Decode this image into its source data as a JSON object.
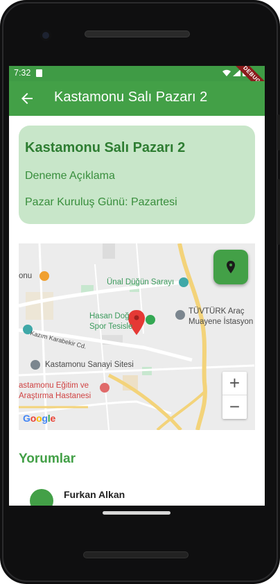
{
  "status_bar": {
    "time": "7:32",
    "debug_label": "DEBUG"
  },
  "app_bar": {
    "title": "Kastamonu Salı Pazarı 2"
  },
  "market_card": {
    "title": "Kastamonu Salı Pazarı 2",
    "description": "Deneme Açıklama",
    "founding_day": "Pazar Kuruluş Günü: Pazartesi"
  },
  "map": {
    "labels": {
      "cafe": "onu",
      "wedding_hall": "Ünal Düğün Sarayı",
      "tuvturk_line1": "TÜVTÜRK Araç",
      "tuvturk_line2": "Muayene İstasyon",
      "sports_line1": "Hasan Doğ",
      "sports_line2": "Spor Tesisle",
      "street": "Kazım Karabekir Cd.",
      "industrial": "Kastamonu Sanayi Sitesi",
      "hospital_line1": "astamonu Eğitim ve",
      "hospital_line2": "Araştırma Hastanesi"
    },
    "zoom_in": "+",
    "zoom_out": "−",
    "attribution": "Google",
    "colors": {
      "road_major": "#f3d37a",
      "park": "#c7e7cf",
      "marker": "#e53935"
    }
  },
  "comments": {
    "section_title": "Yorumlar",
    "items": [
      {
        "user": "Furkan Alkan"
      }
    ]
  },
  "colors": {
    "primary": "#43a047",
    "card_bg": "#c8e6c9",
    "card_text": "#2e7d32"
  }
}
